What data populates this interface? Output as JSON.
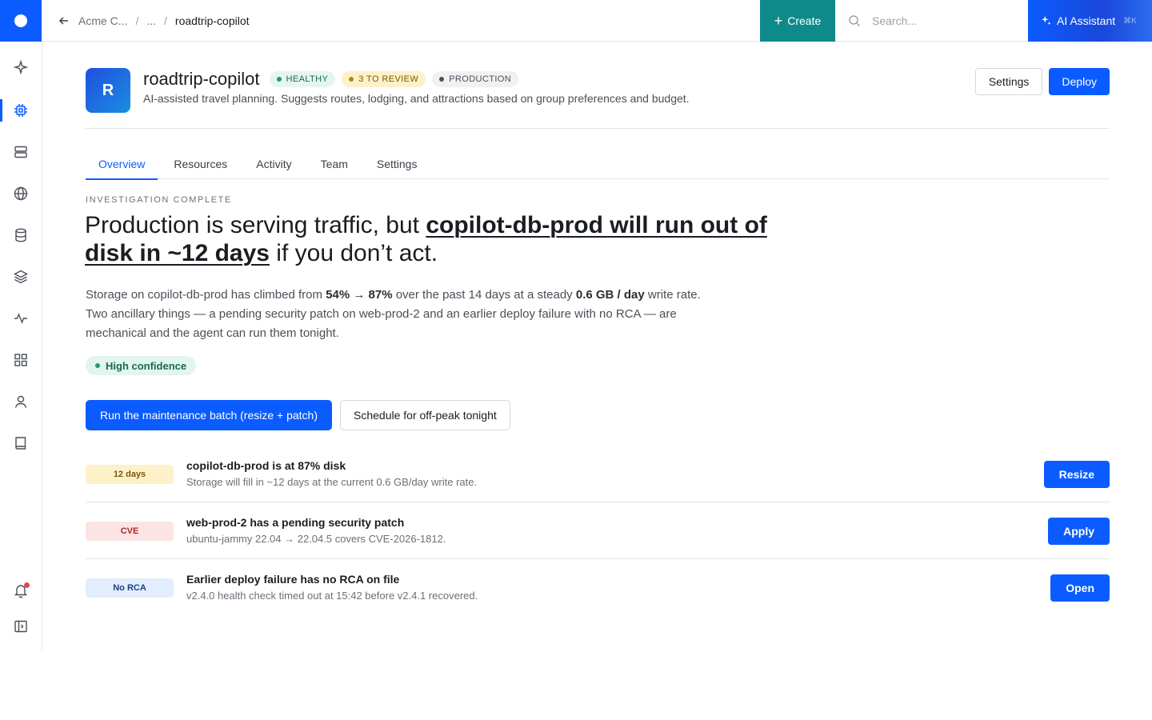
{
  "topbar": {
    "breadcrumbs": {
      "org": "Acme C...",
      "ellipsis": "...",
      "current": "roadtrip-copilot",
      "sep": "/"
    },
    "create_label": "Create",
    "search_placeholder": "Search...",
    "ai_label": "AI Assistant",
    "ai_shortcut": "⌘K"
  },
  "rail": {
    "items": [
      "sparkle-icon",
      "chip-icon",
      "server-icon",
      "globe-icon",
      "database-icon",
      "layers-icon",
      "activity-icon",
      "grid-icon",
      "user-icon",
      "book-icon"
    ],
    "active": "chip-icon",
    "bottom": [
      "bell-icon",
      "panel-toggle-icon"
    ]
  },
  "project": {
    "initial": "R",
    "name": "roadtrip-copilot",
    "badges": {
      "health": "HEALTHY",
      "review": "3 TO REVIEW",
      "env": "PRODUCTION"
    },
    "description": "AI-assisted travel planning. Suggests routes, lodging, and attractions based on group preferences and budget.",
    "settings_label": "Settings",
    "deploy_label": "Deploy"
  },
  "tabs": [
    "Overview",
    "Resources",
    "Activity",
    "Team",
    "Settings"
  ],
  "active_tab": "Overview",
  "investigation": {
    "eyebrow": "INVESTIGATION COMPLETE",
    "headline_pre": "Production is serving traffic, but ",
    "headline_highlight": "copilot-db-prod will run out of disk in ~12 days",
    "headline_post": " if you don’t act.",
    "summary": {
      "p1": "Storage on copilot-db-prod has climbed from ",
      "b1": "54% → 87%",
      "p2": " over the past 14 days at a steady ",
      "b2": "0.6 GB / day",
      "p3": " write rate. Two ancillary things — a pending security patch on web-prod-2 and an earlier deploy failure with no RCA — are mechanical and the agent can run them tonight."
    },
    "confidence": "High confidence",
    "primary_cta": "Run the maintenance batch (resize + patch)",
    "secondary_cta": "Schedule for off-peak tonight"
  },
  "issues": [
    {
      "pill": "12 days",
      "tone": "yellow",
      "title": "copilot-db-prod is at 87% disk",
      "subtitle": "Storage will fill in ~12 days at the current 0.6 GB/day write rate.",
      "action": "Resize"
    },
    {
      "pill": "CVE",
      "tone": "red",
      "title": "web-prod-2 has a pending security patch",
      "subtitle": "ubuntu-jammy 22.04 → 22.04.5 covers CVE-2026-1812.",
      "action": "Apply"
    },
    {
      "pill": "No RCA",
      "tone": "blue",
      "title": "Earlier deploy failure has no RCA on file",
      "subtitle": "v2.4.0 health check timed out at 15:42 before v2.4.1 recovered.",
      "action": "Open"
    }
  ],
  "colors": {
    "accent": "#0b5cff",
    "create": "#0e8a8a",
    "healthy": "#1f9d63",
    "warning": "#b88600",
    "danger": "#a12b2b"
  }
}
